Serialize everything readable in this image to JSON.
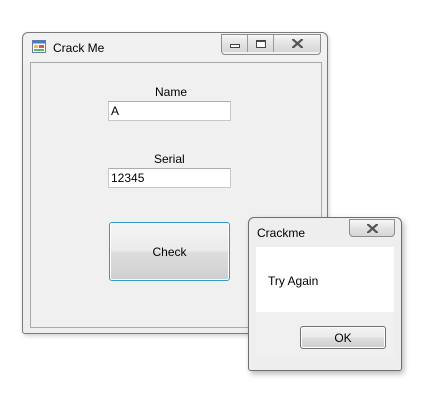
{
  "main_window": {
    "title": "Crack Me",
    "form": {
      "name_label": "Name",
      "name_value": "A",
      "serial_label": "Serial",
      "serial_value": "12345",
      "check_label": "Check"
    }
  },
  "dialog": {
    "title": "Crackme",
    "message": "Try Again",
    "ok_label": "OK"
  },
  "icons": {
    "app": "application-form-icon",
    "minimize": "minimize-icon",
    "maximize": "maximize-icon",
    "close": "close-icon"
  },
  "colors": {
    "focus_border": "#3399cc",
    "window_bg": "#eeeeee",
    "close_glyph": "#555555"
  }
}
